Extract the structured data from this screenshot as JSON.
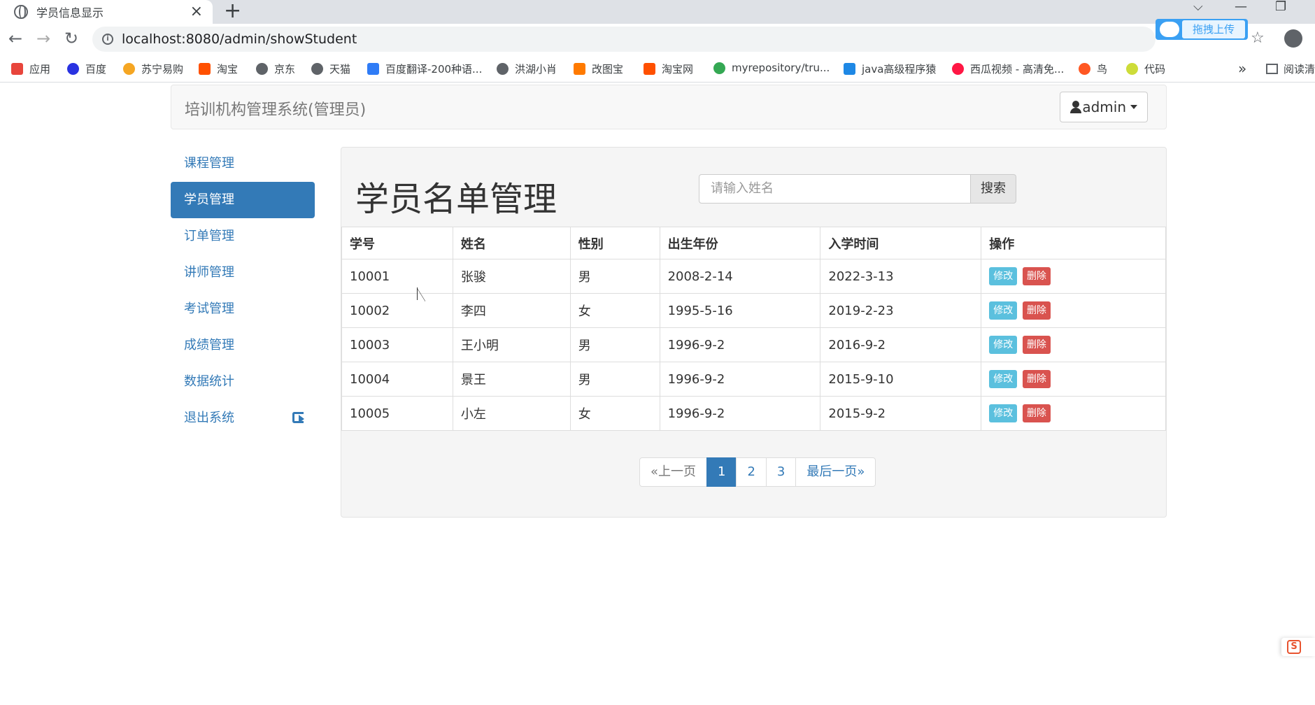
{
  "browser": {
    "tab_title": "学员信息显示",
    "tab_close": "×",
    "new_tab": "+",
    "url": "localhost:8080/admin/showStudent",
    "upload_label": "拖拽上传",
    "bookmarks": [
      {
        "label": "应用",
        "color": "#e8453c"
      },
      {
        "label": "百度",
        "color": "#2932e1"
      },
      {
        "label": "苏宁易购",
        "color": "#f5a623"
      },
      {
        "label": "淘宝",
        "color": "#ff5000"
      },
      {
        "label": "京东",
        "color": "#5f6368"
      },
      {
        "label": "天猫",
        "color": "#5f6368"
      },
      {
        "label": "百度翻译-200种语...",
        "color": "#2f7cf6"
      },
      {
        "label": "洪湖小肖",
        "color": "#5f6368"
      },
      {
        "label": "改图宝",
        "color": "#ff7a00"
      },
      {
        "label": "淘宝网",
        "color": "#ff5000"
      },
      {
        "label": "myrepository/tru...",
        "color": "#34a853"
      },
      {
        "label": "java高级程序猿",
        "color": "#1e88e5"
      },
      {
        "label": "西瓜视频 - 高清免...",
        "color": "#ff1744"
      },
      {
        "label": "鸟",
        "color": "#ff5722"
      },
      {
        "label": "代码",
        "color": "#cddc39"
      }
    ],
    "more": "»",
    "reading_list": "阅读清"
  },
  "navbar": {
    "brand": "培训机构管理系统(管理员)",
    "user": "admin"
  },
  "sidebar": {
    "items": [
      {
        "label": "课程管理",
        "active": false
      },
      {
        "label": "学员管理",
        "active": true
      },
      {
        "label": "订单管理",
        "active": false
      },
      {
        "label": "讲师管理",
        "active": false
      },
      {
        "label": "考试管理",
        "active": false
      },
      {
        "label": "成绩管理",
        "active": false
      },
      {
        "label": "数据统计",
        "active": false
      },
      {
        "label": "退出系统",
        "active": false
      }
    ]
  },
  "main": {
    "title": "学员名单管理",
    "search_placeholder": "请输入姓名",
    "search_button": "搜索",
    "table": {
      "headers": [
        "学号",
        "姓名",
        "性别",
        "出生年份",
        "入学时间",
        "操作"
      ],
      "rows": [
        [
          "10001",
          "张骏",
          "男",
          "2008-2-14",
          "2022-3-13"
        ],
        [
          "10002",
          "李四",
          "女",
          "1995-5-16",
          "2019-2-23"
        ],
        [
          "10003",
          "王小明",
          "男",
          "1996-9-2",
          "2016-9-2"
        ],
        [
          "10004",
          "景王",
          "男",
          "1996-9-2",
          "2015-9-10"
        ],
        [
          "10005",
          "小左",
          "女",
          "1996-9-2",
          "2015-9-2"
        ]
      ],
      "edit_label": "修改",
      "delete_label": "删除"
    },
    "pagination": {
      "prev": "«上一页",
      "pages": [
        "1",
        "2",
        "3"
      ],
      "current": "1",
      "last": "最后一页»"
    }
  },
  "colors": {
    "primary": "#337ab7",
    "info": "#5bc0de",
    "danger": "#d9534f"
  }
}
